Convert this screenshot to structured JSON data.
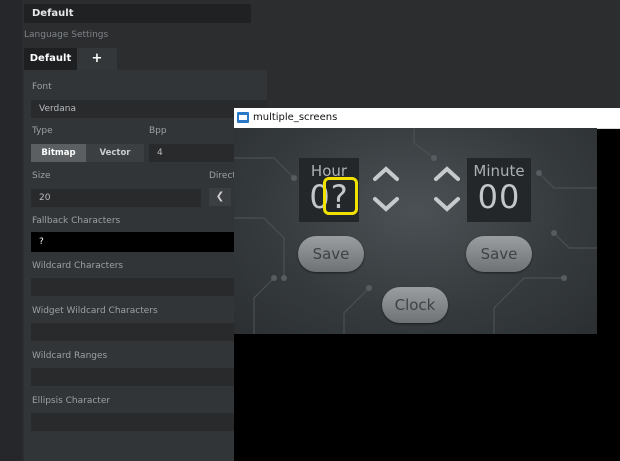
{
  "top_field": {
    "value": "Default"
  },
  "language_settings": {
    "label": "Language Settings"
  },
  "tabs": {
    "default": "Default",
    "add": "+"
  },
  "font": {
    "label": "Font",
    "value": "Verdana"
  },
  "type": {
    "label": "Type",
    "options": [
      "Bitmap",
      "Vector"
    ],
    "selected": "Bitmap"
  },
  "bpp": {
    "label": "Bpp",
    "value": "4"
  },
  "size": {
    "label": "Size",
    "value": "20"
  },
  "direction": {
    "label": "Direct"
  },
  "fallback": {
    "label": "Fallback Characters",
    "value": "?"
  },
  "wildcard": {
    "label": "Wildcard Characters"
  },
  "widget_wildcard": {
    "label": "Widget Wildcard Characters"
  },
  "wildcard_ranges": {
    "label": "Wildcard Ranges"
  },
  "ellipsis": {
    "label": "Ellipsis Character"
  },
  "window": {
    "title": "multiple_screens",
    "hour": {
      "label": "Hour",
      "value_first": "0",
      "value_second": "?"
    },
    "minute": {
      "label": "Minute",
      "value": "00"
    },
    "save_left": "Save",
    "save_right": "Save",
    "clock": "Clock"
  },
  "colors": {
    "highlight": "#f2e200",
    "panel": "#323537"
  }
}
